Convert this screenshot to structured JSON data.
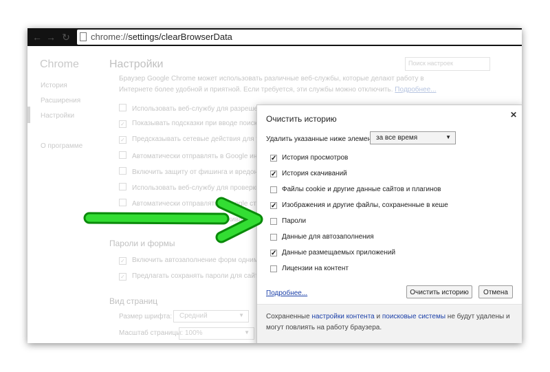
{
  "toolbar": {
    "back_icon": "arrow-left-icon",
    "forward_icon": "arrow-right-icon",
    "reload_icon": "reload-icon",
    "url_scheme": "chrome://",
    "url_path": "settings/clearBrowserData"
  },
  "sidebar": {
    "title": "Chrome",
    "items": [
      {
        "label": "История"
      },
      {
        "label": "Расширения"
      },
      {
        "label": "Настройки"
      },
      {
        "label": "О программе"
      }
    ]
  },
  "settings": {
    "title": "Настройки",
    "search_placeholder": "Поиск настроек",
    "description": "Браузер Google Chrome может использовать различные веб-службы, которые делают работу в Интернете более удобной и приятной. Если требуется, эти службы можно отключить.",
    "description_link": "Подробнее...",
    "privacy_options": [
      {
        "label": "Использовать веб-службу для разрешения проблем, связанных с навигацией",
        "checked": false
      },
      {
        "label": "Показывать подсказки при вводе поисковых запросов и URL в адресной строке",
        "checked": true
      },
      {
        "label": "Предсказывать сетевые действия для ускорения загрузки страниц",
        "checked": true
      },
      {
        "label": "Автоматически отправлять в Google информацию о возможных угрозах",
        "checked": false
      },
      {
        "label": "Включить защиту от фишинга и вредоносного ПО",
        "checked": false
      },
      {
        "label": "Использовать веб-службу для проверки правописания",
        "checked": false
      },
      {
        "label": "Автоматически отправлять в Google статистику использования и отчеты о сбоях",
        "checked": false
      },
      {
        "label": "Отправлять запрос \"Не отслеживать\"",
        "checked": false
      }
    ],
    "passwords_section": "Пароли и формы",
    "passwords_options": [
      {
        "label": "Включить автозаполнение форм одним кликом",
        "checked": true
      },
      {
        "label": "Предлагать сохранять пароли для сайтов Настроить",
        "checked": true
      }
    ],
    "view_section": "Вид страниц",
    "font_size_label": "Размер шрифта:",
    "font_size_value": "Средний",
    "zoom_label": "Масштаб страницы:",
    "zoom_value": "100%"
  },
  "dialog": {
    "title": "Очистить историю",
    "close_icon": "close-icon",
    "remove_label": "Удалить указанные ниже элементы",
    "period_value": "за все время",
    "items": [
      {
        "label": "История просмотров",
        "checked": true
      },
      {
        "label": "История скачиваний",
        "checked": true
      },
      {
        "label": "Файлы cookie и другие данные сайтов и плагинов",
        "checked": false
      },
      {
        "label": "Изображения и другие файлы, сохраненные в кеше",
        "checked": true
      },
      {
        "label": "Пароли",
        "checked": false
      },
      {
        "label": "Данные для автозаполнения",
        "checked": false
      },
      {
        "label": "Данные размещаемых приложений",
        "checked": true
      },
      {
        "label": "Лицензии на контент",
        "checked": false
      }
    ],
    "more_link": "Подробнее...",
    "clear_button": "Очистить историю",
    "cancel_button": "Отмена",
    "footer_pre": "Сохраненные ",
    "footer_link1": "настройки контента",
    "footer_mid": " и ",
    "footer_link2": "поисковые системы",
    "footer_post": " не будут удалены и могут повлиять на работу браузера."
  },
  "annotation": {
    "icon": "green-arrow-icon",
    "color": "#22cc22",
    "points_to": "Пароли"
  }
}
